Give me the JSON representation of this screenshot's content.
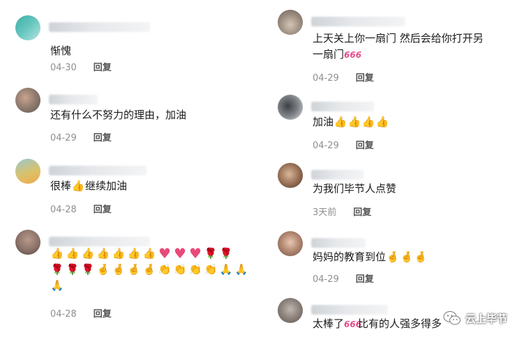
{
  "left_comments": [
    {
      "text": "惭愧",
      "date": "04-30",
      "reply": "回复"
    },
    {
      "text": "还有什么不努力的理由，加油",
      "date": "04-29",
      "reply": "回复"
    },
    {
      "text_before": "很棒",
      "text_after": "继续加油",
      "date": "04-28",
      "reply": "回复"
    },
    {
      "date": "04-28",
      "reply": "回复"
    }
  ],
  "right_comments": [
    {
      "text_line1": "上天关上你一扇门 然后会给你打开另",
      "text_line2": "一扇门",
      "date": "04-29",
      "reply": "回复"
    },
    {
      "text": "加油",
      "date": "04-29",
      "reply": "回复"
    },
    {
      "text": "为我们毕节人点赞",
      "date": "3天前",
      "reply": "回复"
    },
    {
      "text": "妈妈的教育到位",
      "date": "04-29",
      "reply": "回复"
    },
    {
      "text_before": "太棒了",
      "text_after": "比有的人强多得多"
    }
  ],
  "watermark": {
    "label": "云上毕节",
    "icon": "wechat-icon"
  },
  "emoji": {
    "thumb": "👍",
    "heart": "♥",
    "rose": "🌹",
    "clap": "👏",
    "pray": "🙏",
    "fingers": "🤞",
    "six": "666"
  }
}
